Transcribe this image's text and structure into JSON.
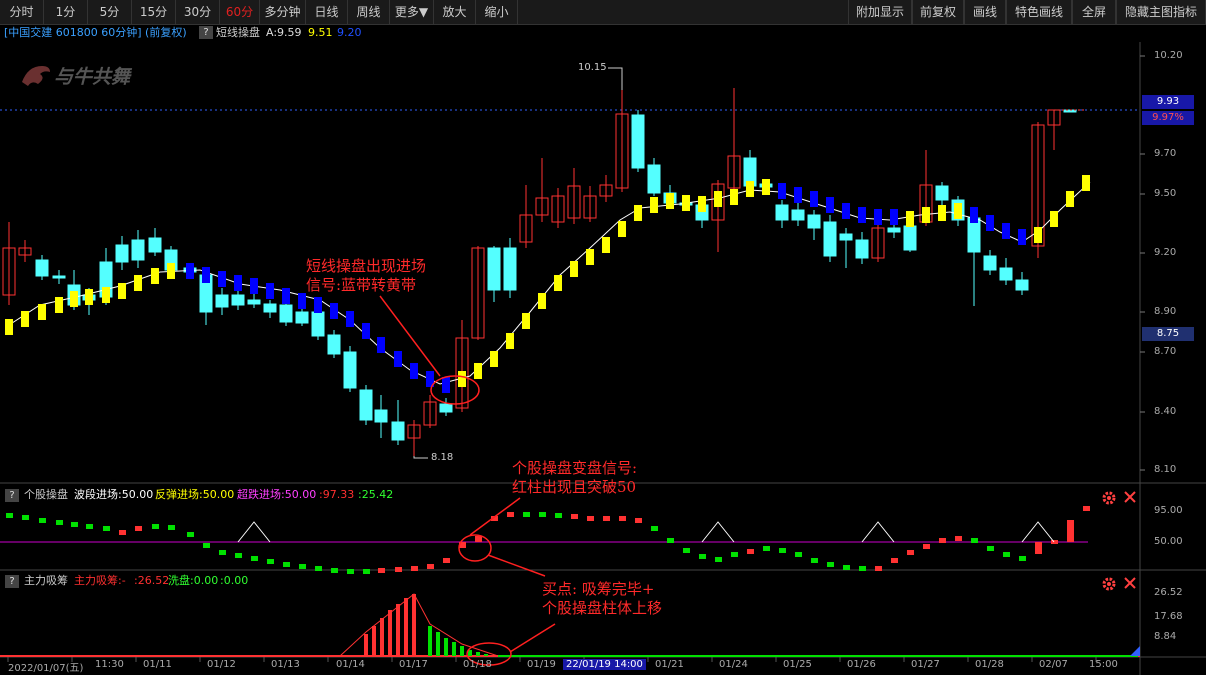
{
  "toolbar": {
    "left": [
      {
        "label": "分时",
        "w": 44
      },
      {
        "label": "1分",
        "w": 44
      },
      {
        "label": "5分",
        "w": 44
      },
      {
        "label": "15分",
        "w": 44
      },
      {
        "label": "30分",
        "w": 44
      },
      {
        "label": "60分",
        "w": 40,
        "active": true
      },
      {
        "label": "多分钟",
        "w": 46
      },
      {
        "label": "日线",
        "w": 42
      },
      {
        "label": "周线",
        "w": 42
      },
      {
        "label": "更多▼",
        "w": 44
      },
      {
        "label": "放大",
        "w": 42
      },
      {
        "label": "缩小",
        "w": 42
      }
    ],
    "right": [
      {
        "label": "附加显示",
        "w": 64
      },
      {
        "label": "前复权",
        "w": 52
      },
      {
        "label": "画线",
        "w": 42
      },
      {
        "label": "特色画线",
        "w": 66
      },
      {
        "label": "全屏",
        "w": 44
      },
      {
        "label": "隐藏主图指标",
        "w": 90
      }
    ]
  },
  "info": {
    "stock": "[中国交建 601800 60分钟] (前复权)",
    "question": "?",
    "indicator": "短线操盘",
    "value_a": "A:9.59",
    "value_b": "9.51",
    "value_c": "9.20"
  },
  "price_axis": [
    "10.20",
    "9.70",
    "9.50",
    "9.20",
    "8.90",
    "8.70",
    "8.40",
    "8.10"
  ],
  "price_tags": {
    "last": "9.93",
    "pct": "9.97%",
    "low_tag": "8.75"
  },
  "high_label": "10.15",
  "low_label": "8.18",
  "logo_text": "与牛共舞",
  "panel1": {
    "question": "?",
    "name": "个股操盘",
    "l1": "波段进场:50.00",
    "l2": "反弹进场:50.00",
    "l3": "超跌进场:50.00",
    "l4": ":97.33",
    "l5": ":25.42",
    "axis": [
      "95.00",
      "50.00"
    ]
  },
  "panel2": {
    "question": "?",
    "name": "主力吸筹",
    "l1": "主力吸筹:-",
    "l2": ":26.52",
    "l3": "洗盘:0.00",
    "l4": ":0.00",
    "axis": [
      "26.52",
      "17.68",
      "8.84"
    ]
  },
  "xaxis": [
    "2022/01/07(五)",
    "11:30",
    "01/11",
    "01/12",
    "01/13",
    "01/14",
    "01/17",
    "01/18",
    "01/19",
    "22/01/19 14:00",
    "01/21",
    "01/24",
    "01/25",
    "01/26",
    "01/27",
    "01/28",
    "02/07",
    "15:00"
  ],
  "annotations": {
    "a1_l1": "短线操盘出现进场",
    "a1_l2": "信号:蓝带转黄带",
    "a2_l1": "个股操盘变盘信号:",
    "a2_l2": "红柱出现且突破50",
    "a3_l1": "买点: 吸筹完毕+",
    "a3_l2": "个股操盘柱体上移"
  },
  "colors": {
    "up": "#ff3232",
    "down": "#54ffff",
    "yellow": "#ffff00",
    "blue": "#0000ff",
    "purple": "#cc00cc",
    "green": "#00e000"
  }
}
